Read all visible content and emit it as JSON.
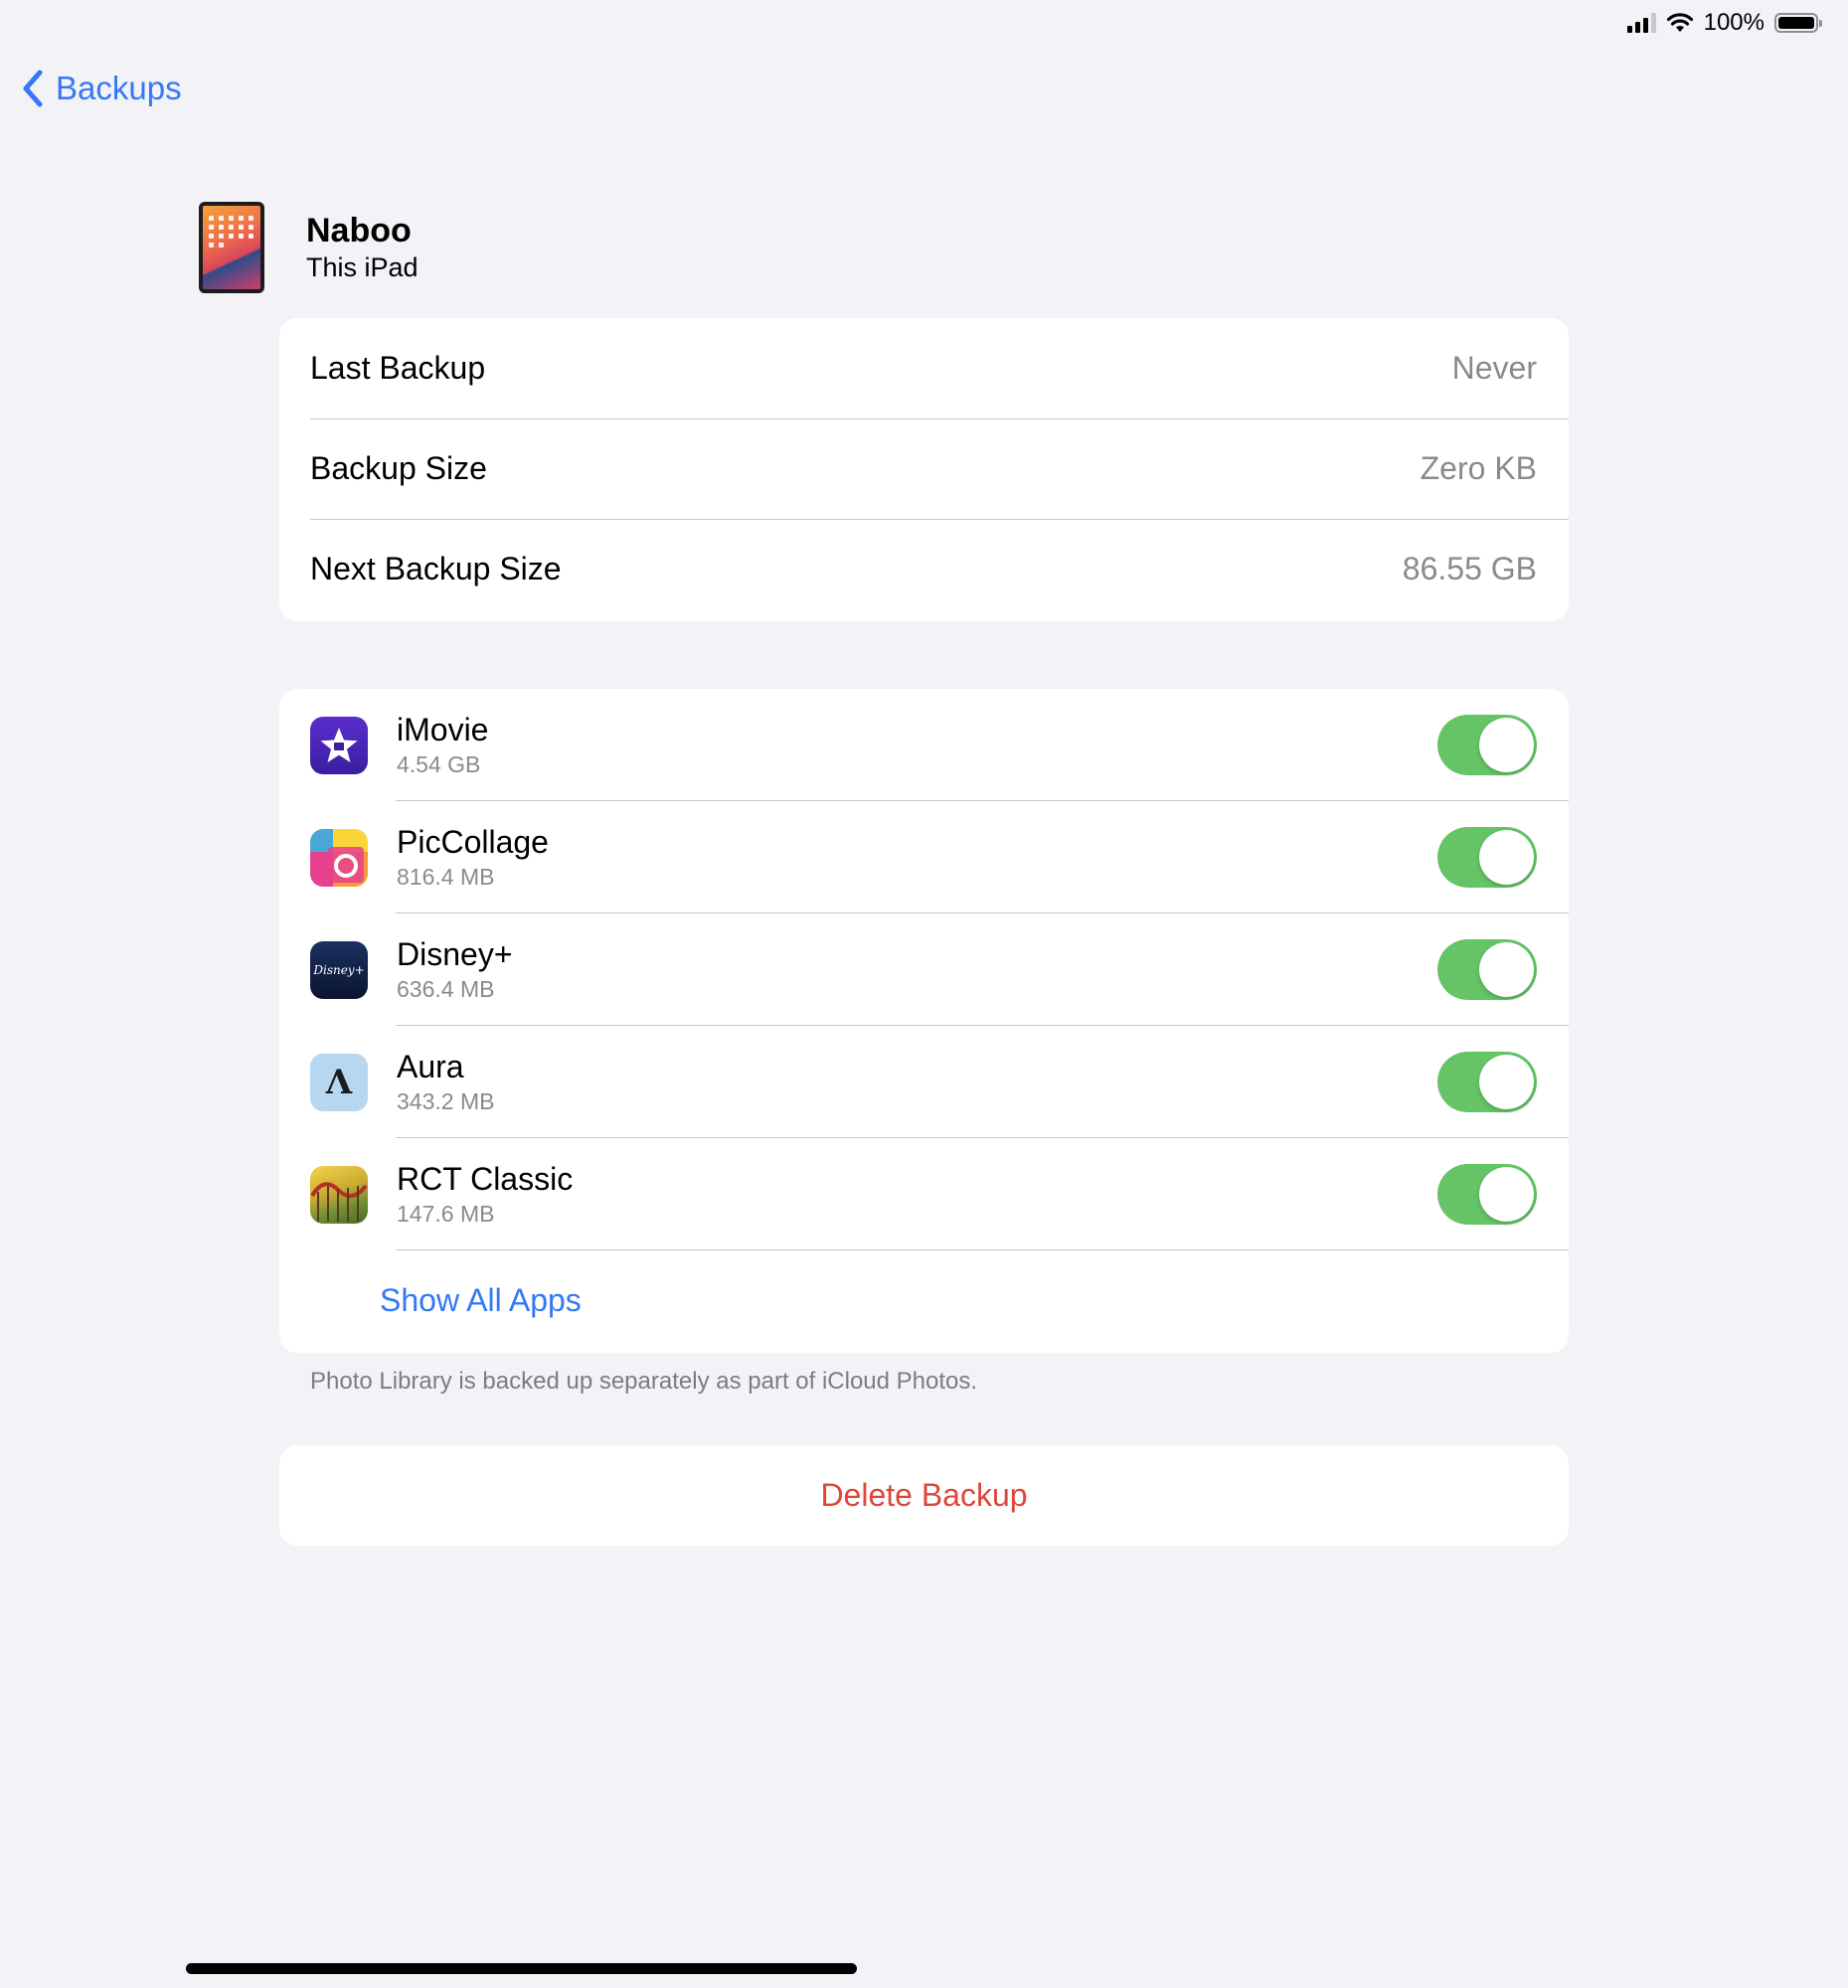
{
  "status_bar": {
    "battery_text": "100%",
    "battery_level": 1.0
  },
  "nav": {
    "back_label": "Backups",
    "back_icon": "chevron-left-icon",
    "accent_color": "#3478f6"
  },
  "device": {
    "name": "Naboo",
    "subtitle": "This iPad",
    "icon": "ipad-icon"
  },
  "backup_info": [
    {
      "label": "Last Backup",
      "value": "Never"
    },
    {
      "label": "Backup Size",
      "value": "Zero KB"
    },
    {
      "label": "Next Backup Size",
      "value": "86.55 GB"
    }
  ],
  "apps": [
    {
      "name": "iMovie",
      "size": "4.54 GB",
      "icon": "imovie-icon",
      "enabled": true
    },
    {
      "name": "PicCollage",
      "size": "816.4 MB",
      "icon": "piccollage-icon",
      "enabled": true
    },
    {
      "name": "Disney+",
      "size": "636.4 MB",
      "icon": "disney-plus-icon",
      "icon_text": "Disney+",
      "enabled": true
    },
    {
      "name": "Aura",
      "size": "343.2 MB",
      "icon": "aura-icon",
      "icon_text": "Λ",
      "enabled": true
    },
    {
      "name": "RCT Classic",
      "size": "147.6 MB",
      "icon": "rct-classic-icon",
      "enabled": true
    }
  ],
  "show_all_label": "Show All Apps",
  "footnote": "Photo Library is backed up separately as part of iCloud Photos.",
  "delete_label": "Delete Backup",
  "colors": {
    "background": "#f2f2f7",
    "toggle_on": "#65c466",
    "destructive": "#e0453a"
  }
}
